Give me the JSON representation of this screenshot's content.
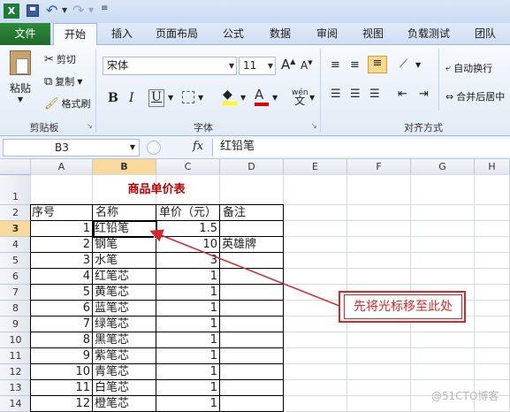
{
  "qat": {
    "title_icons": [
      "excel-icon",
      "save-icon",
      "undo-icon",
      "redo-icon",
      "customize-icon"
    ]
  },
  "tabs": [
    "文件",
    "开始",
    "插入",
    "页面布局",
    "公式",
    "数据",
    "审阅",
    "视图",
    "负载测试",
    "团队"
  ],
  "ribbon": {
    "clipboard": {
      "paste": "粘贴",
      "cut": "剪切",
      "copy": "复制",
      "format_painter": "格式刷",
      "label": "剪贴板"
    },
    "font": {
      "name": "宋体",
      "size": "11",
      "label": "字体",
      "bold": "B",
      "italic": "I",
      "underline": "U",
      "phonetic": "wén"
    },
    "alignment": {
      "wrap": "自动换行",
      "merge": "合并后居中",
      "label": "对齐方式"
    }
  },
  "formula_bar": {
    "name_box": "B3",
    "fx": "fx",
    "content": "红铅笔"
  },
  "columns": [
    "A",
    "B",
    "C",
    "D",
    "E",
    "F",
    "G",
    "H"
  ],
  "rows": [
    "1",
    "2",
    "3",
    "4",
    "5",
    "6",
    "7",
    "8",
    "9",
    "10",
    "11",
    "12",
    "13",
    "14"
  ],
  "sheet": {
    "title": "商品单价表",
    "headers": [
      "序号",
      "名称",
      "单价（元）",
      "备注"
    ],
    "data": [
      {
        "no": "1",
        "name": "红铅笔",
        "price": "1.5",
        "note": ""
      },
      {
        "no": "2",
        "name": "钢笔",
        "price": "10",
        "note": "英雄牌"
      },
      {
        "no": "3",
        "name": "水笔",
        "price": "3",
        "note": ""
      },
      {
        "no": "4",
        "name": "红笔芯",
        "price": "1",
        "note": ""
      },
      {
        "no": "5",
        "name": "黄笔芯",
        "price": "1",
        "note": ""
      },
      {
        "no": "6",
        "name": "蓝笔芯",
        "price": "1",
        "note": ""
      },
      {
        "no": "7",
        "name": "绿笔芯",
        "price": "1",
        "note": ""
      },
      {
        "no": "8",
        "name": "黑笔芯",
        "price": "1",
        "note": ""
      },
      {
        "no": "9",
        "name": "紫笔芯",
        "price": "1",
        "note": ""
      },
      {
        "no": "10",
        "name": "青笔芯",
        "price": "1",
        "note": ""
      },
      {
        "no": "11",
        "name": "白笔芯",
        "price": "1",
        "note": ""
      },
      {
        "no": "12",
        "name": "橙笔芯",
        "price": "1",
        "note": ""
      }
    ]
  },
  "annotation": {
    "text": "先将光标移至此处"
  },
  "watermark": "@51CTO博客",
  "colors": {
    "title_red": "#c00000",
    "annotation_red": "#d9262b",
    "file_tab": "#217a31"
  }
}
